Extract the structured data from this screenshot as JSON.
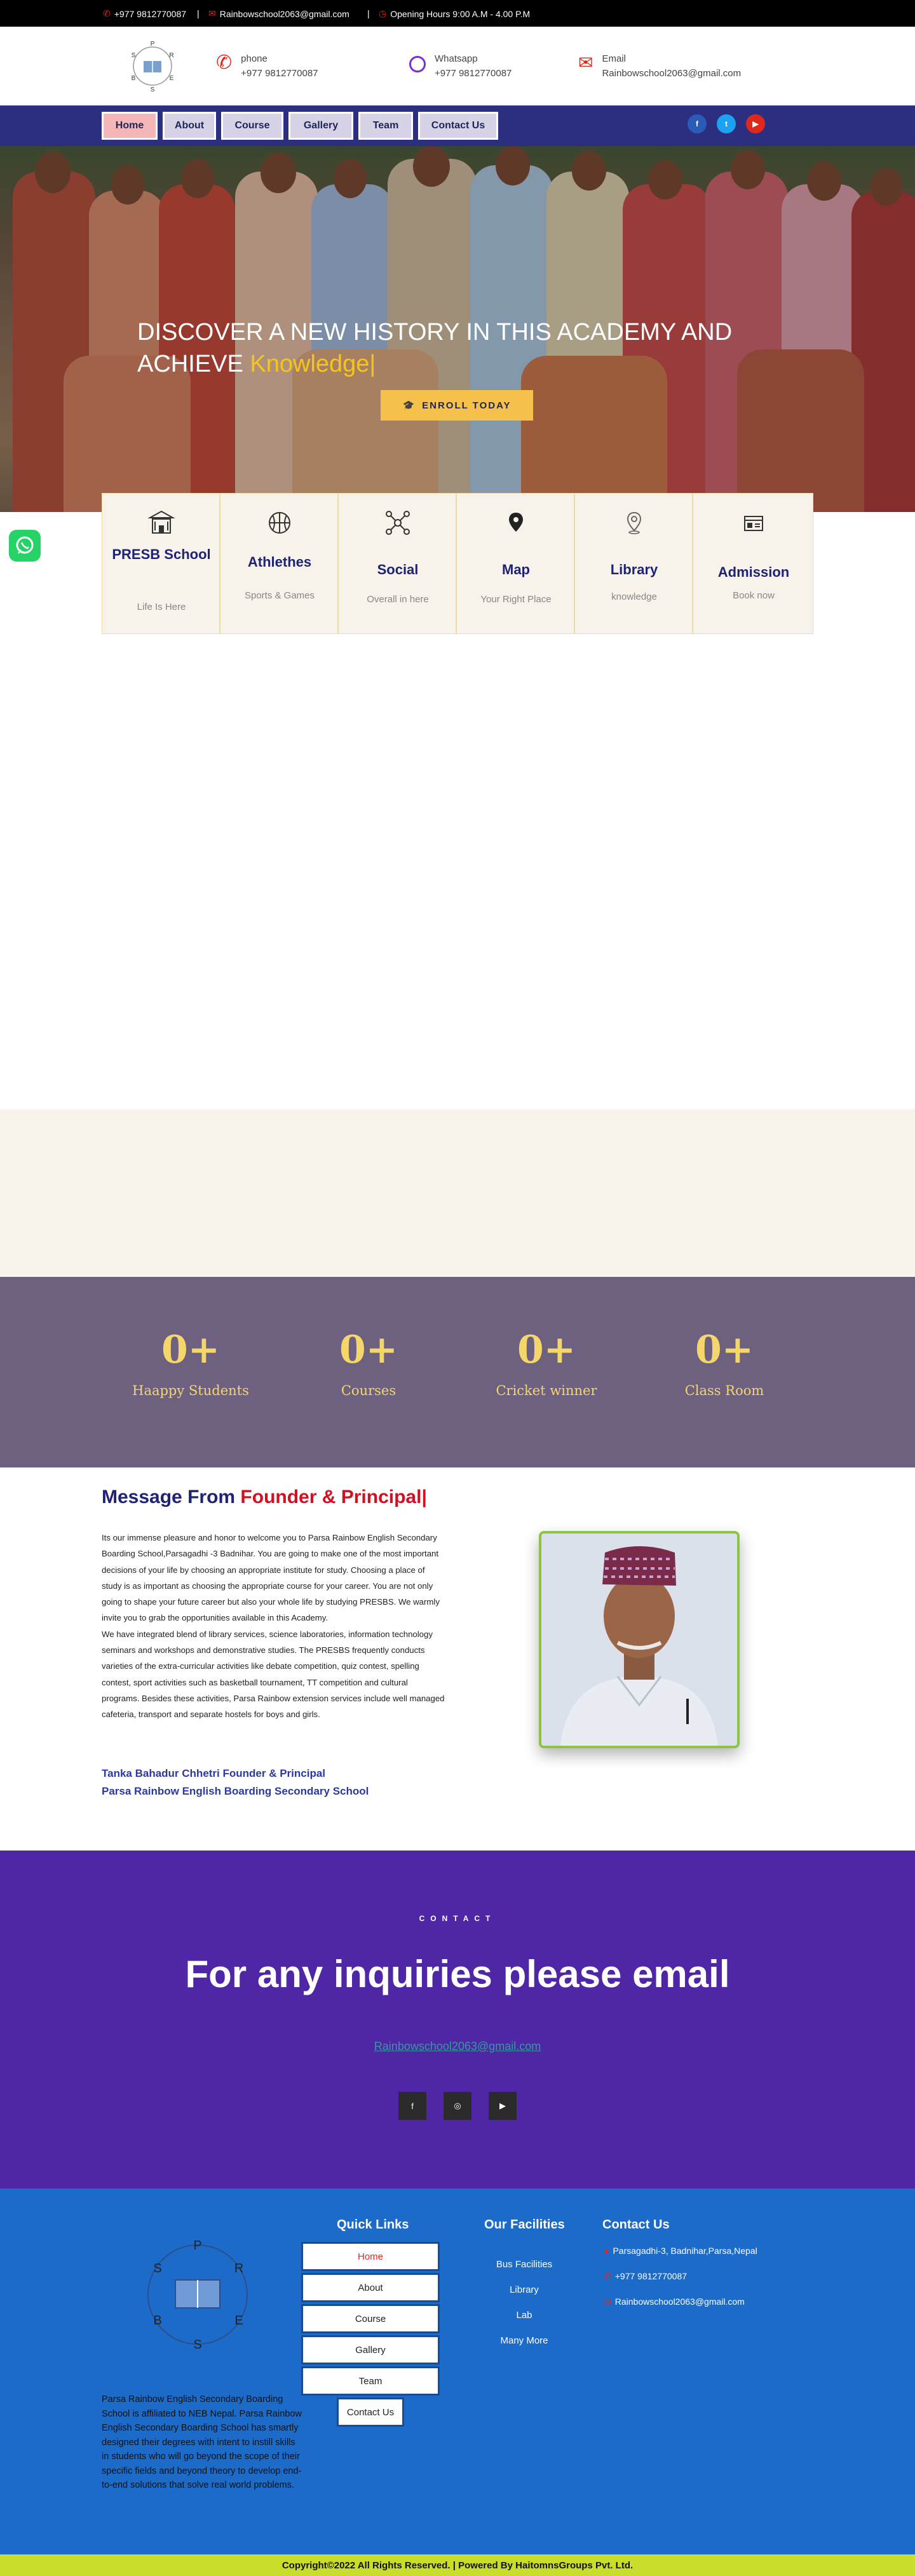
{
  "topbar": {
    "phone": "+977 9812770087",
    "email": "Rainbowschool2063@gmail.com",
    "hours": "Opening Hours 9:00 A.M - 4.00 P.M",
    "sep": "|"
  },
  "header": {
    "logo_letters": [
      "P",
      "S",
      "R",
      "B",
      "E",
      "S"
    ],
    "phone_label": "phone",
    "phone_value": "+977 9812770087",
    "whatsapp_label": "Whatsapp",
    "whatsapp_value": "+977 9812770087",
    "email_label": "Email",
    "email_value": "Rainbowschool2063@gmail.com"
  },
  "nav": {
    "items": [
      "Home",
      "About",
      "Course",
      "Gallery",
      "Team",
      "Contact Us"
    ],
    "social": [
      "f",
      "t",
      "▶"
    ]
  },
  "hero": {
    "title_line1": "DISCOVER A NEW HISTORY IN THIS ACADEMY AND",
    "title_line2": "ACHIEVE",
    "title_highlight": "Knowledge|",
    "enroll_label": "ENROLL TODAY"
  },
  "features": [
    {
      "title": "PRESB School",
      "sub": "Life Is Here",
      "icon": "school-icon"
    },
    {
      "title": "Athlethes",
      "sub": "Sports & Games",
      "icon": "basketball-icon"
    },
    {
      "title": "Social",
      "sub": "Overall in here",
      "icon": "network-icon"
    },
    {
      "title": "Map",
      "sub": "Your Right Place",
      "icon": "map-pin-icon"
    },
    {
      "title": "Library",
      "sub": "knowledge",
      "icon": "location-icon"
    },
    {
      "title": "Admission",
      "sub": "Book now",
      "icon": "calendar-icon"
    }
  ],
  "stats": [
    {
      "value": "0+",
      "label": "Haappy Students"
    },
    {
      "value": "0+",
      "label": "Courses"
    },
    {
      "value": "0+",
      "label": "Cricket winner"
    },
    {
      "value": "0+",
      "label": "Class Room"
    }
  ],
  "message": {
    "title_a": "Message From",
    "title_b": "Founder & Principal|",
    "para1": "Its our immense pleasure and honor to welcome you to Parsa Rainbow English Secondary Boarding School,Parsagadhi -3 Badnihar. You are going to make one of the most important decisions of your life by choosing an appropriate institute for study. Choosing a place of study is as important as choosing the appropriate course for your career. You are not only going to shape your future career but also your whole life by studying PRESBS. We warmly invite you to grab the opportunities available in this Academy.",
    "para2": "We have integrated blend of library services, science laboratories, information technology seminars and workshops and demonstrative studies. The PRESBS frequently conducts varieties of the extra-curricular activities like debate competition, quiz contest, spelling contest, sport activities such as basketball tournament, TT competition and cultural programs. Besides these activities, Parsa Rainbow extension services include well managed cafeteria, transport and separate hostels for boys and girls.",
    "sig1": "Tanka Bahadur Chhetri Founder & Principal",
    "sig2": "Parsa Rainbow English Boarding Secondary School"
  },
  "contact": {
    "caption": "CONTACT",
    "heading": "For any inquiries please email",
    "email": "Rainbowschool2063@gmail.com",
    "social": [
      "f",
      "◎",
      "▶"
    ]
  },
  "footer": {
    "quick_title": "Quick Links",
    "quick_links": [
      "Home",
      "About",
      "Course",
      "Gallery",
      "Team",
      "Contact Us"
    ],
    "fac_title": "Our Facilities",
    "facilities": [
      "Bus Facilities",
      "Library",
      "Lab",
      "Many More"
    ],
    "contact_title": "Contact Us",
    "address": "Parsagadhi-3, Badnihar,Parsa,Nepal",
    "phone": "+977 9812770087",
    "email": "Rainbowschool2063@gmail.com",
    "about": "Parsa Rainbow English Secondary Boarding School is affiliated to NEB Nepal. Parsa Rainbow English Secondary Boarding School has smartly designed their degrees with intent to instill skills in students who will go beyond the scope of their specific fields and beyond theory to develop end-to-end solutions that solve real world problems.",
    "copyright": "Copyright©2022 All Rights Reserved. | Powered By HaitomnsGroups Pvt. Ltd."
  },
  "colors": {
    "nav_bg": "#2c2e80",
    "accent_yellow": "#f5c14a",
    "stats_bg": "#6e6180",
    "contact_bg": "#4f27a6",
    "footer_bg": "#1c6bc8",
    "copyright_bg": "#c8de2b"
  }
}
